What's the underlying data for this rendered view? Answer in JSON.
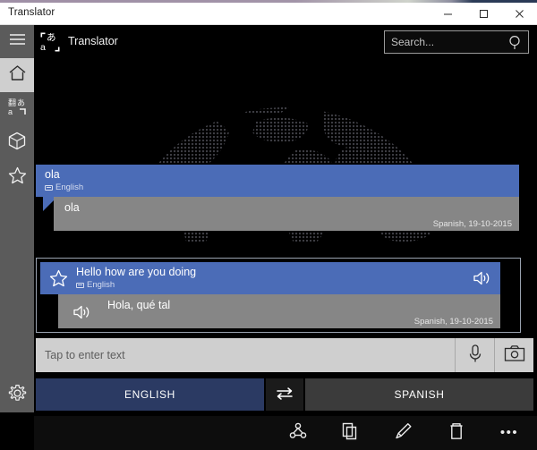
{
  "window": {
    "title": "Translator",
    "minimize_label": "Minimize",
    "maximize_label": "Maximize",
    "close_label": "Close"
  },
  "rail": {
    "items": [
      {
        "name": "menu",
        "label": "Menu",
        "icon": "hamburger-icon",
        "selected": false
      },
      {
        "name": "home",
        "label": "Home",
        "icon": "home-icon",
        "selected": true
      },
      {
        "name": "translate",
        "label": "Translate",
        "icon": "translate-icon",
        "selected": false
      },
      {
        "name": "packs",
        "label": "Language packs",
        "icon": "cube-icon",
        "selected": false
      },
      {
        "name": "favorites",
        "label": "Favorites",
        "icon": "star-icon",
        "selected": false
      }
    ],
    "settings": {
      "label": "Settings",
      "icon": "gear-icon"
    }
  },
  "header": {
    "logo_icon": "translator-logo-icon",
    "app_title": "Translator",
    "search": {
      "placeholder": "Search...",
      "value": "",
      "icon": "search-icon"
    }
  },
  "background": {
    "watermark": "dotted-world-map"
  },
  "conversation": [
    {
      "id": "entry-1",
      "selected": false,
      "starred": false,
      "source_text": "ola",
      "source_lang": "English",
      "source_lang_icon": "keyboard-icon",
      "has_speaker_source": false,
      "target_text": "ola",
      "has_speaker_target": false,
      "meta": "Spanish, 19-10-2015"
    },
    {
      "id": "entry-2",
      "selected": true,
      "starred": true,
      "star_icon": "star-icon",
      "source_text": "Hello how are you doing",
      "source_lang": "English",
      "source_lang_icon": "keyboard-icon",
      "has_speaker_source": true,
      "speaker_source_icon": "speaker-icon",
      "target_text": "Hola, qué tal",
      "has_speaker_target": true,
      "speaker_target_icon": "speaker-icon",
      "meta": "Spanish, 19-10-2015"
    }
  ],
  "input": {
    "placeholder": "Tap to enter text",
    "value": "",
    "mic_icon": "microphone-icon",
    "camera_icon": "camera-icon"
  },
  "languages": {
    "from": "ENGLISH",
    "to": "SPANISH",
    "swap_icon": "swap-arrows-icon"
  },
  "appbar": {
    "buttons": [
      {
        "name": "share",
        "label": "Share",
        "icon": "share-icon"
      },
      {
        "name": "copy",
        "label": "Copy",
        "icon": "copy-icon"
      },
      {
        "name": "edit",
        "label": "Edit",
        "icon": "pencil-icon"
      },
      {
        "name": "delete",
        "label": "Delete",
        "icon": "trash-icon"
      },
      {
        "name": "more",
        "label": "More",
        "icon": "ellipsis-icon"
      }
    ],
    "more_glyph": "•••"
  },
  "colors": {
    "accent_blue": "#4b6cb7",
    "translation_gray": "#868686",
    "rail_gray": "#5b5b5b",
    "lang_from": "#2b3a63",
    "lang_to": "#3b3b3b",
    "input_bg": "#cfcfcf"
  }
}
